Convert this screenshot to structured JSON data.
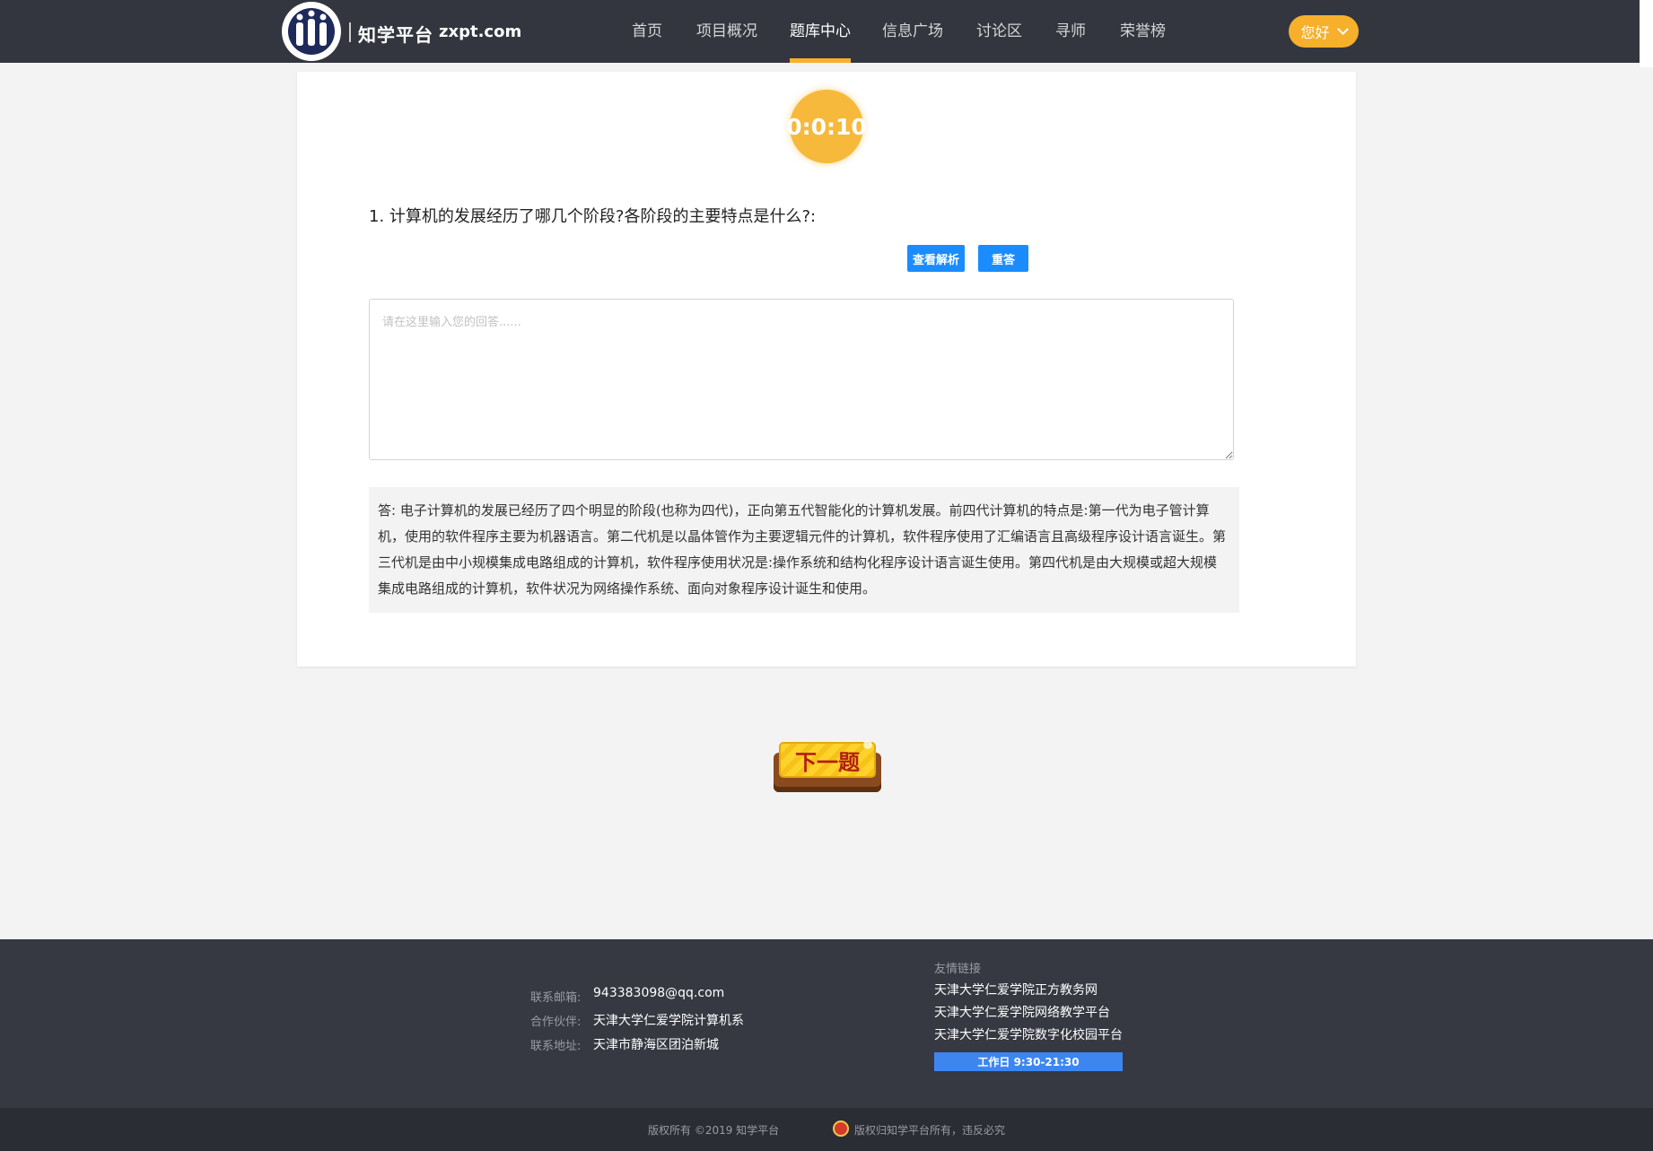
{
  "header": {
    "brand_name": "知学平台",
    "brand_domain": "zxpt.com",
    "nav": [
      "首页",
      "项目概况",
      "题库中心",
      "信息广场",
      "讨论区",
      "寻师",
      "荣誉榜"
    ],
    "active_nav": "题库中心",
    "greeting": "您好",
    "accent_color": "#f6b02c"
  },
  "quiz": {
    "timer": "0:0:10",
    "question": "1. 计算机的发展经历了哪几个阶段?各阶段的主要特点是什么?:",
    "view_analysis_label": "查看解析",
    "reanswer_label": "重答",
    "answer_placeholder": "请在这里输入您的回答......",
    "answer_value": "",
    "analysis": "答: 电子计算机的发展已经历了四个明显的阶段(也称为四代)，正向第五代智能化的计算机发展。前四代计算机的特点是:第一代为电子管计算机，使用的软件程序主要为机器语言。第二代机是以晶体管作为主要逻辑元件的计算机，软件程序使用了汇编语言且高级程序设计语言诞生。第三代机是由中小规模集成电路组成的计算机，软件程序使用状况是:操作系统和结构化程序设计语言诞生使用。第四代机是由大规模或超大规模集成电路组成的计算机，软件状况为网络操作系统、面向对象程序设计诞生和使用。",
    "next_label": "下一题"
  },
  "footer": {
    "email_label": "联系邮箱:",
    "email": "943383098@qq.com",
    "partner_label": "合作伙伴:",
    "partner": "天津大学仁爱学院计算机系",
    "address_label": "联系地址:",
    "address": "天津市静海区团泊新城",
    "links_title": "友情链接",
    "links": [
      "天津大学仁爱学院正方教务网",
      "天津大学仁爱学院网络教学平台",
      "天津大学仁爱学院数字化校园平台"
    ],
    "workday": "工作日 9:30-21:30",
    "copyright": "版权所有 ©2019 知学平台",
    "rights": "版权归知学平台所有，违反必究"
  }
}
